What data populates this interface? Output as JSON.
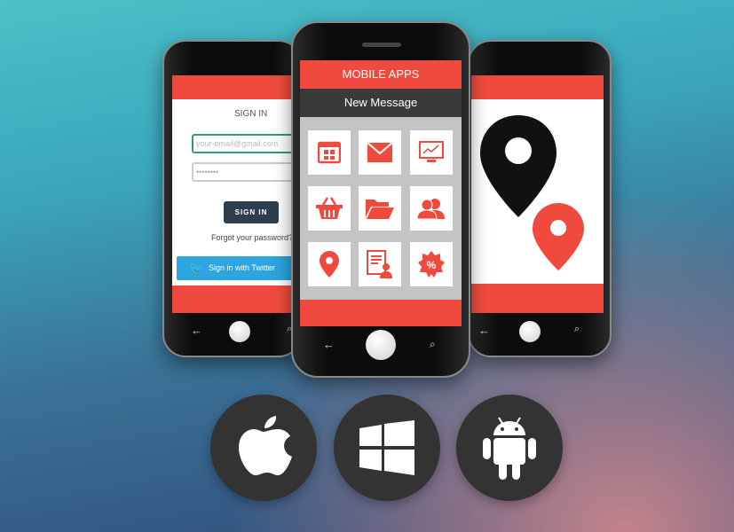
{
  "signin_screen": {
    "title": "SIGN IN",
    "email_placeholder": "your-email@gmail.com",
    "password_value": "••••••••",
    "signin_button": "SIGN IN",
    "forgot_link": "Forgot your password?",
    "twitter_button": "Sign in with Twitter"
  },
  "apps_screen": {
    "header": "MOBILE APPS",
    "subheader": "New Message",
    "tiles": [
      "calendar-icon",
      "mail-icon",
      "chart-monitor-icon",
      "basket-icon",
      "folder-icon",
      "users-icon",
      "location-pin-icon",
      "document-user-icon",
      "discount-badge-icon"
    ]
  },
  "map_screen": {
    "pins": [
      "black-location-pin",
      "red-location-pin"
    ]
  },
  "platforms": [
    "apple-icon",
    "windows-icon",
    "android-icon"
  ],
  "colors": {
    "accent": "#f04a3e",
    "dark_header": "#3a3a3a",
    "twitter": "#2ca5e0",
    "signin_button": "#2e3d50",
    "email_border": "#2a9d7f"
  }
}
